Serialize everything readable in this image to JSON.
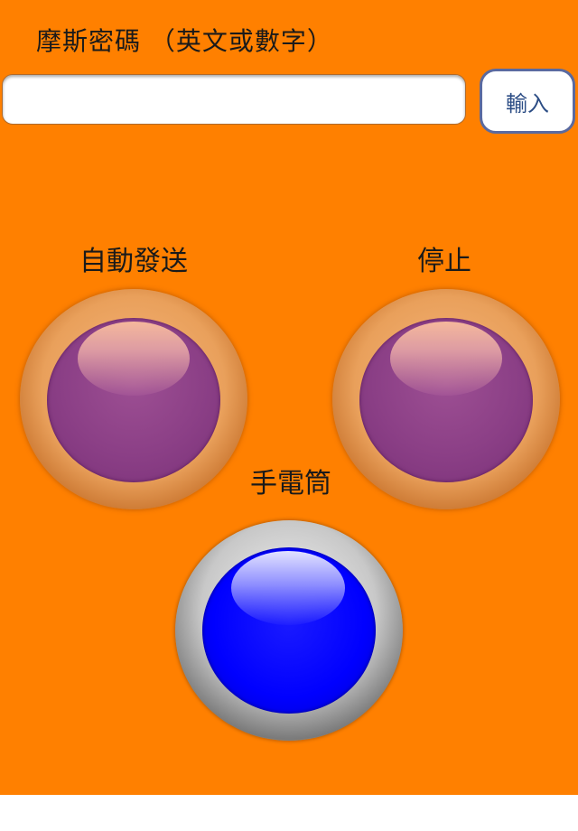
{
  "header": {
    "title": "摩斯密碼 （英文或數字）"
  },
  "input": {
    "value": "",
    "placeholder": "",
    "submit_label": "輸入"
  },
  "controls": {
    "auto_send_label": "自動發送",
    "stop_label": "停止",
    "flashlight_label": "手電筒"
  },
  "colors": {
    "background": "#ff8000",
    "auto_send_button": "#8b3f86",
    "stop_button": "#8b3f86",
    "flashlight_button": "#0000ff"
  }
}
